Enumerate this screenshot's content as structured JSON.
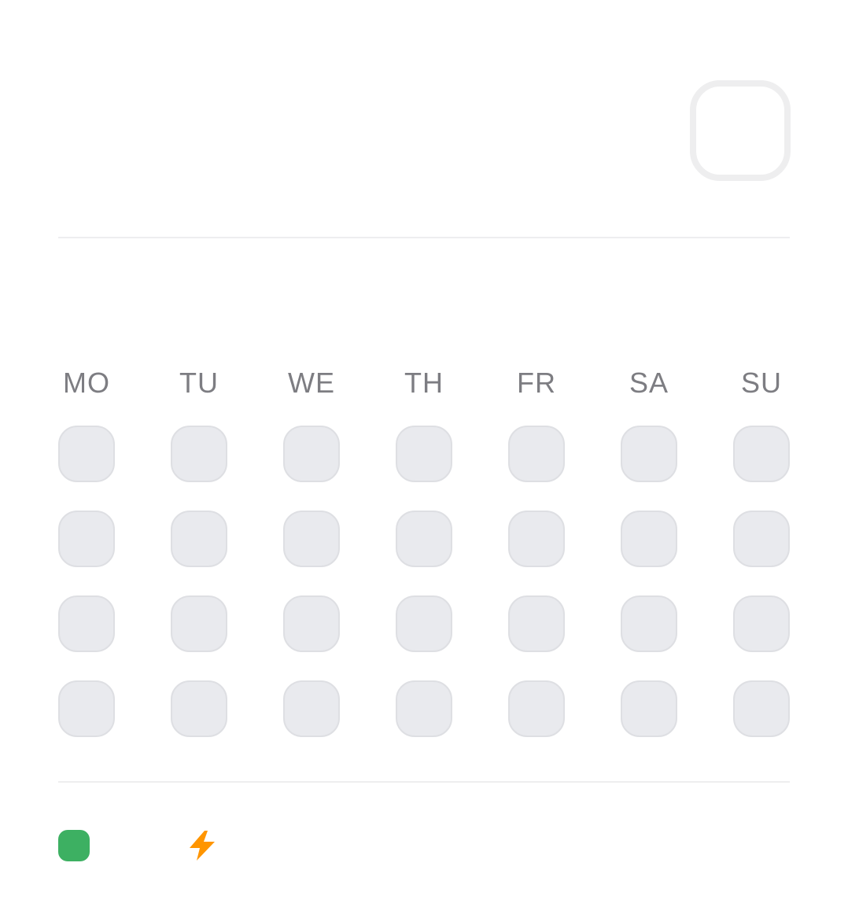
{
  "colors": {
    "success": "#3db062",
    "bolt": "#ff9500",
    "cell_fill": "#e9eaee",
    "cell_border": "#dedfe3"
  },
  "top_icon": {
    "name": "empty-square-icon"
  },
  "calendar": {
    "weekdays": [
      "MO",
      "TU",
      "WE",
      "TH",
      "FR",
      "SA",
      "SU"
    ],
    "weeks_shown": 4,
    "days_per_week": 7
  },
  "legend": {
    "items": [
      {
        "icon": "green-square-icon"
      },
      {
        "icon": "lightning-bolt-icon"
      }
    ]
  }
}
